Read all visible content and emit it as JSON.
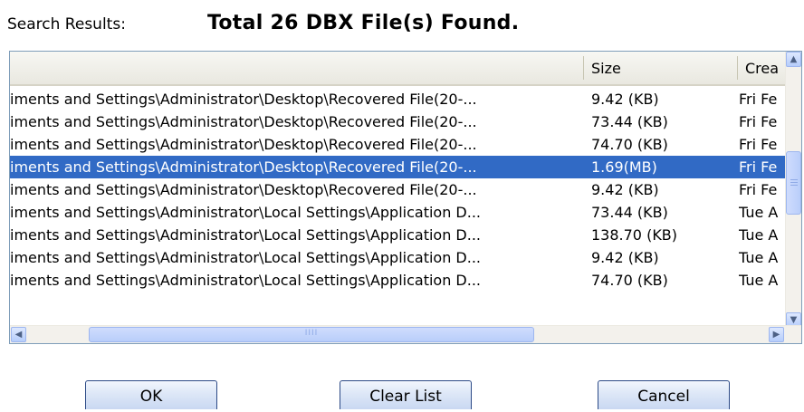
{
  "search": {
    "label": "Search Results:",
    "total": "Total 26 DBX File(s) Found."
  },
  "table": {
    "columns": [
      "",
      "Size",
      "Crea"
    ],
    "rows": [
      {
        "path": "iments and Settings\\Administrator\\Desktop\\Recovered File(20-...",
        "size": "9.42 (KB)",
        "created": "Fri Fe"
      },
      {
        "path": "iments and Settings\\Administrator\\Desktop\\Recovered File(20-...",
        "size": "73.44 (KB)",
        "created": "Fri Fe"
      },
      {
        "path": "iments and Settings\\Administrator\\Desktop\\Recovered File(20-...",
        "size": "74.70 (KB)",
        "created": "Fri Fe"
      },
      {
        "path": "iments and Settings\\Administrator\\Desktop\\Recovered File(20-...",
        "size": "1.69(MB)",
        "created": "Fri Fe",
        "selected": true
      },
      {
        "path": "iments and Settings\\Administrator\\Desktop\\Recovered File(20-...",
        "size": "9.42 (KB)",
        "created": "Fri Fe"
      },
      {
        "path": "iments and Settings\\Administrator\\Local Settings\\Application D...",
        "size": "73.44 (KB)",
        "created": "Tue A"
      },
      {
        "path": "iments and Settings\\Administrator\\Local Settings\\Application D...",
        "size": "138.70 (KB)",
        "created": "Tue A"
      },
      {
        "path": "iments and Settings\\Administrator\\Local Settings\\Application D...",
        "size": "9.42 (KB)",
        "created": "Tue A"
      },
      {
        "path": "iments and Settings\\Administrator\\Local Settings\\Application D...",
        "size": "74.70 (KB)",
        "created": "Tue A"
      }
    ]
  },
  "scroll": {
    "up": "▲",
    "down": "▼",
    "left": "◀",
    "right": "▶",
    "grip": "IIII"
  },
  "buttons": {
    "ok": "OK",
    "clear": "Clear List",
    "cancel": "Cancel"
  },
  "colors": {
    "selection": "#316ac5",
    "button_border": "#2c4a86"
  }
}
